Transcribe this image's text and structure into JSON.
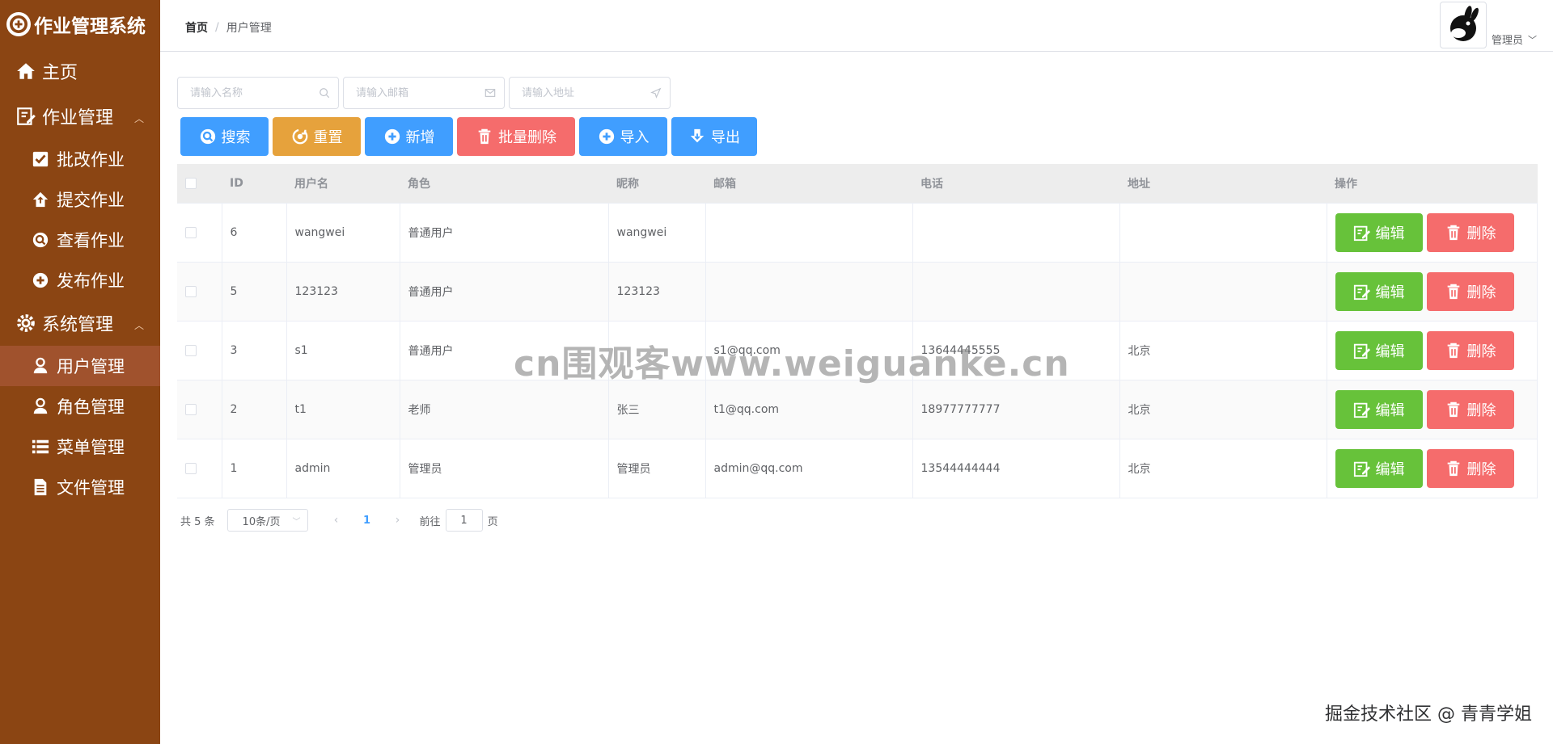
{
  "sidebar": {
    "brand": "作业管理系统",
    "brand_icon": "logo-plus-circle-icon",
    "items": [
      {
        "label": "主页",
        "icon": "home-icon"
      },
      {
        "label": "作业管理",
        "icon": "edit-document-icon",
        "expanded": true
      },
      {
        "label": "批改作业",
        "icon": "checkbox-icon"
      },
      {
        "label": "提交作业",
        "icon": "upload-house-icon"
      },
      {
        "label": "查看作业",
        "icon": "search-circle-icon"
      },
      {
        "label": "发布作业",
        "icon": "plus-circle-icon"
      },
      {
        "label": "系统管理",
        "icon": "gear-icon",
        "expanded": true
      },
      {
        "label": "用户管理",
        "icon": "user-icon",
        "active": true
      },
      {
        "label": "角色管理",
        "icon": "user-icon"
      },
      {
        "label": "菜单管理",
        "icon": "list-icon"
      },
      {
        "label": "文件管理",
        "icon": "file-icon"
      }
    ]
  },
  "header": {
    "breadcrumb_home": "首页",
    "breadcrumb_sep": "/",
    "breadcrumb_current": "用户管理",
    "user_name": "管理员",
    "avatar_icon": "rabbit-avatar-icon"
  },
  "search": {
    "name_placeholder": "请输入名称",
    "email_placeholder": "请输入邮箱",
    "address_placeholder": "请输入地址"
  },
  "toolbar": {
    "search": "搜索",
    "reset": "重置",
    "add": "新增",
    "batch_delete": "批量删除",
    "import": "导入",
    "export": "导出"
  },
  "table": {
    "columns": [
      "ID",
      "用户名",
      "角色",
      "昵称",
      "邮箱",
      "电话",
      "地址",
      "操作"
    ],
    "rows": [
      {
        "id": "6",
        "username": "wangwei",
        "role": "普通用户",
        "nickname": "wangwei",
        "email": "",
        "phone": "",
        "address": ""
      },
      {
        "id": "5",
        "username": "123123",
        "role": "普通用户",
        "nickname": "123123",
        "email": "",
        "phone": "",
        "address": ""
      },
      {
        "id": "3",
        "username": "s1",
        "role": "普通用户",
        "nickname": "",
        "email": "s1@qq.com",
        "phone": "13644445555",
        "address": "北京"
      },
      {
        "id": "2",
        "username": "t1",
        "role": "老师",
        "nickname": "张三",
        "email": "t1@qq.com",
        "phone": "18977777777",
        "address": "北京"
      },
      {
        "id": "1",
        "username": "admin",
        "role": "管理员",
        "nickname": "管理员",
        "email": "admin@qq.com",
        "phone": "13544444444",
        "address": "北京"
      }
    ],
    "edit_label": "编辑",
    "delete_label": "删除"
  },
  "pager": {
    "total": "共 5 条",
    "page_size": "10条/页",
    "prev": "‹",
    "current_page": "1",
    "next": "›",
    "jump_prefix": "前往",
    "jump_value": "1",
    "jump_suffix": "页"
  },
  "watermark": "cn围观客www.weiguanke.cn",
  "footer_mark": "掘金技术社区 @ 青青学姐",
  "colors": {
    "sidebar": "#8b4513",
    "sidebar_active": "#a0522d",
    "primary": "#409eff",
    "warning": "#e6a23c",
    "danger": "#f56c6c",
    "success": "#67c23a"
  }
}
